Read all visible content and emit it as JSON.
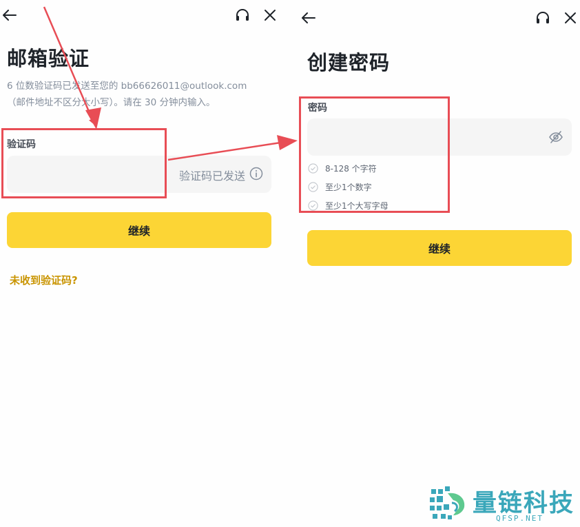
{
  "left": {
    "title": "邮箱验证",
    "description_line1": "6 位数验证码已发送至您的 bb66626011@outlook.com",
    "description_line2": "（邮件地址不区分大小写）。请在 30 分钟内输入。",
    "field_label": "验证码",
    "code_value": "",
    "sent_status": "验证码已发送",
    "continue_label": "继续",
    "resend_link": "未收到验证码?"
  },
  "right": {
    "title": "创建密码",
    "field_label": "密码",
    "password_value": "",
    "rules": [
      "8-128 个字符",
      "至少1个数字",
      "至少1个大写字母"
    ],
    "continue_label": "继续"
  },
  "icons": {
    "back": "arrow-left-icon",
    "support": "headset-icon",
    "close": "close-icon",
    "visibility": "eye-off-icon",
    "info": "info-icon",
    "rule_check": "check-circle-icon"
  },
  "colors": {
    "accent_yellow": "#fcd535",
    "link_gold": "#c99400",
    "annotation_red": "#e84d55",
    "watermark_teal": "#3aa7ba",
    "input_bg": "#f5f5f5"
  },
  "watermark": {
    "text_cn": "量链科技",
    "text_en": "QFSP.NET"
  }
}
